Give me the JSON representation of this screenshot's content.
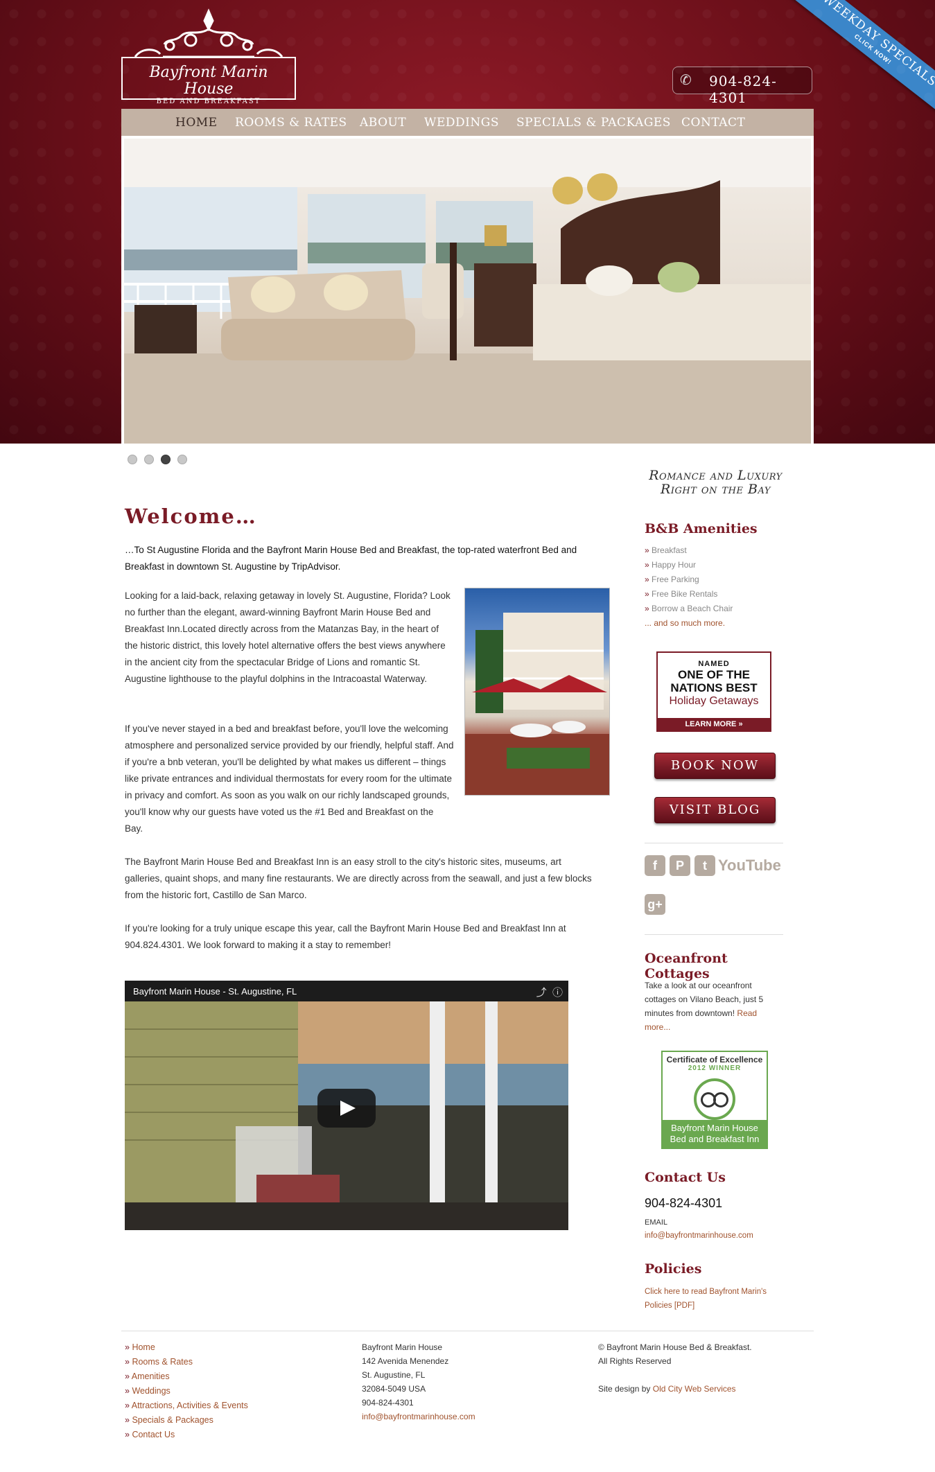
{
  "header": {
    "logo_name": "Bayfront Marin House",
    "logo_sub": "BED AND BREAKFAST",
    "phone": "904-824-4301",
    "ribbon_main": "WEEKDAY SPECIALS",
    "ribbon_sub": "CLICK NOW!",
    "phone_icon": "phone-icon"
  },
  "nav": {
    "items": [
      "HOME",
      "ROOMS & RATES",
      "ABOUT",
      "WEDDINGS",
      "SPECIALS & PACKAGES",
      "CONTACT"
    ],
    "active": "HOME"
  },
  "slider": {
    "count": 4,
    "active_index": 2
  },
  "main": {
    "heading": "Welcome…",
    "intro": "…To St Augustine Florida and the Bayfront Marin House Bed and Breakfast, the top-rated waterfront Bed and Breakfast in downtown St. Augustine by TripAdvisor.",
    "p1": "Looking for a laid-back, relaxing getaway in lovely St. Augustine, Florida?  Look no further than the elegant, award-winning Bayfront Marin House Bed and Breakfast Inn.Located directly across from the Matanzas Bay, in the heart of the historic district, this lovely hotel alternative offers the best views anywhere in the ancient city from the spectacular Bridge of Lions and romantic St. Augustine lighthouse to the playful dolphins in the Intracoastal Waterway.",
    "p2": "If you've never stayed in a bed and breakfast before, you'll love the welcoming atmosphere and personalized service provided by our friendly, helpful staff. And if you're a bnb veteran, you'll be delighted by what makes us different – things like private entrances and individual thermostats for every room for the ultimate in privacy and comfort. As soon as you walk on our richly landscaped grounds, you'll know why our guests have voted us the #1 Bed and Breakfast on the Bay.",
    "p3": "The Bayfront Marin House Bed and Breakfast Inn is an easy stroll to the city's historic sites, museums, art galleries, quaint shops, and many fine restaurants. We are directly across from the seawall, and just a few blocks from the historic fort, Castillo de San Marco.",
    "p4": "If you're looking for a truly unique escape this year, call the Bayfront Marin House Bed and Breakfast Inn at 904.824.4301. We look forward to making it a stay to remember!",
    "video_title": "Bayfront Marin House - St. Augustine, FL"
  },
  "sidebar": {
    "tagline_1": "Romance and Luxury",
    "tagline_2": "Right on the Bay",
    "amenities_heading": "B&B Amenities",
    "amenities": [
      "Breakfast",
      "Happy Hour",
      "Free Parking",
      "Free Bike Rentals",
      "Borrow a Beach Chair"
    ],
    "amenities_more": "... and so much more.",
    "badge_named": "NAMED",
    "badge_line1": "ONE OF THE NATIONS BEST",
    "badge_line2": "Holiday Getaways",
    "badge_learn": "LEARN MORE »",
    "book_now": "BOOK NOW",
    "visit_blog": "VISIT  BLOG",
    "social": {
      "facebook": "f",
      "pinterest": "P",
      "twitter": "t",
      "youtube": "YouTube",
      "gplus": "g+"
    },
    "cottages_heading": "Oceanfront Cottages",
    "cottages_text": "Take a look at our oceanfront cottages on Vilano Beach, just 5 minutes from downtown!",
    "cottages_link": "Read more...",
    "cert_title": "Certificate of Excellence",
    "cert_year": "2012 WINNER",
    "cert_name": "Bayfront Marin House Bed and Breakfast Inn",
    "contact_heading": "Contact Us",
    "contact_phone": "904-824-4301",
    "contact_email_label": "EMAIL",
    "contact_email": "info@bayfrontmarinhouse.com",
    "policies_heading": "Policies",
    "policies_link": "Click here to read Bayfront Marin's Policies [PDF]"
  },
  "footer": {
    "links": [
      "Home",
      "Rooms & Rates",
      "Amenities",
      "Weddings",
      "Attractions, Activities & Events",
      "Specials & Packages",
      "Contact Us"
    ],
    "address_name": "Bayfront Marin House",
    "address_street": "142 Avenida Menendez",
    "address_city": "St. Augustine, FL",
    "address_zip": "32084-5049 USA",
    "address_phone": "904-824-4301",
    "address_email": "info@bayfrontmarinhouse.com",
    "copyright": "© Bayfront Marin House Bed & Breakfast.",
    "rights": "All Rights Reserved",
    "design_prefix": "Site design by",
    "design_link": "Old City Web Services"
  },
  "colors": {
    "brand": "#7a1b26",
    "nav_bg": "#c3b2a4",
    "link": "#a0522d",
    "ribbon": "#3b86c9"
  }
}
